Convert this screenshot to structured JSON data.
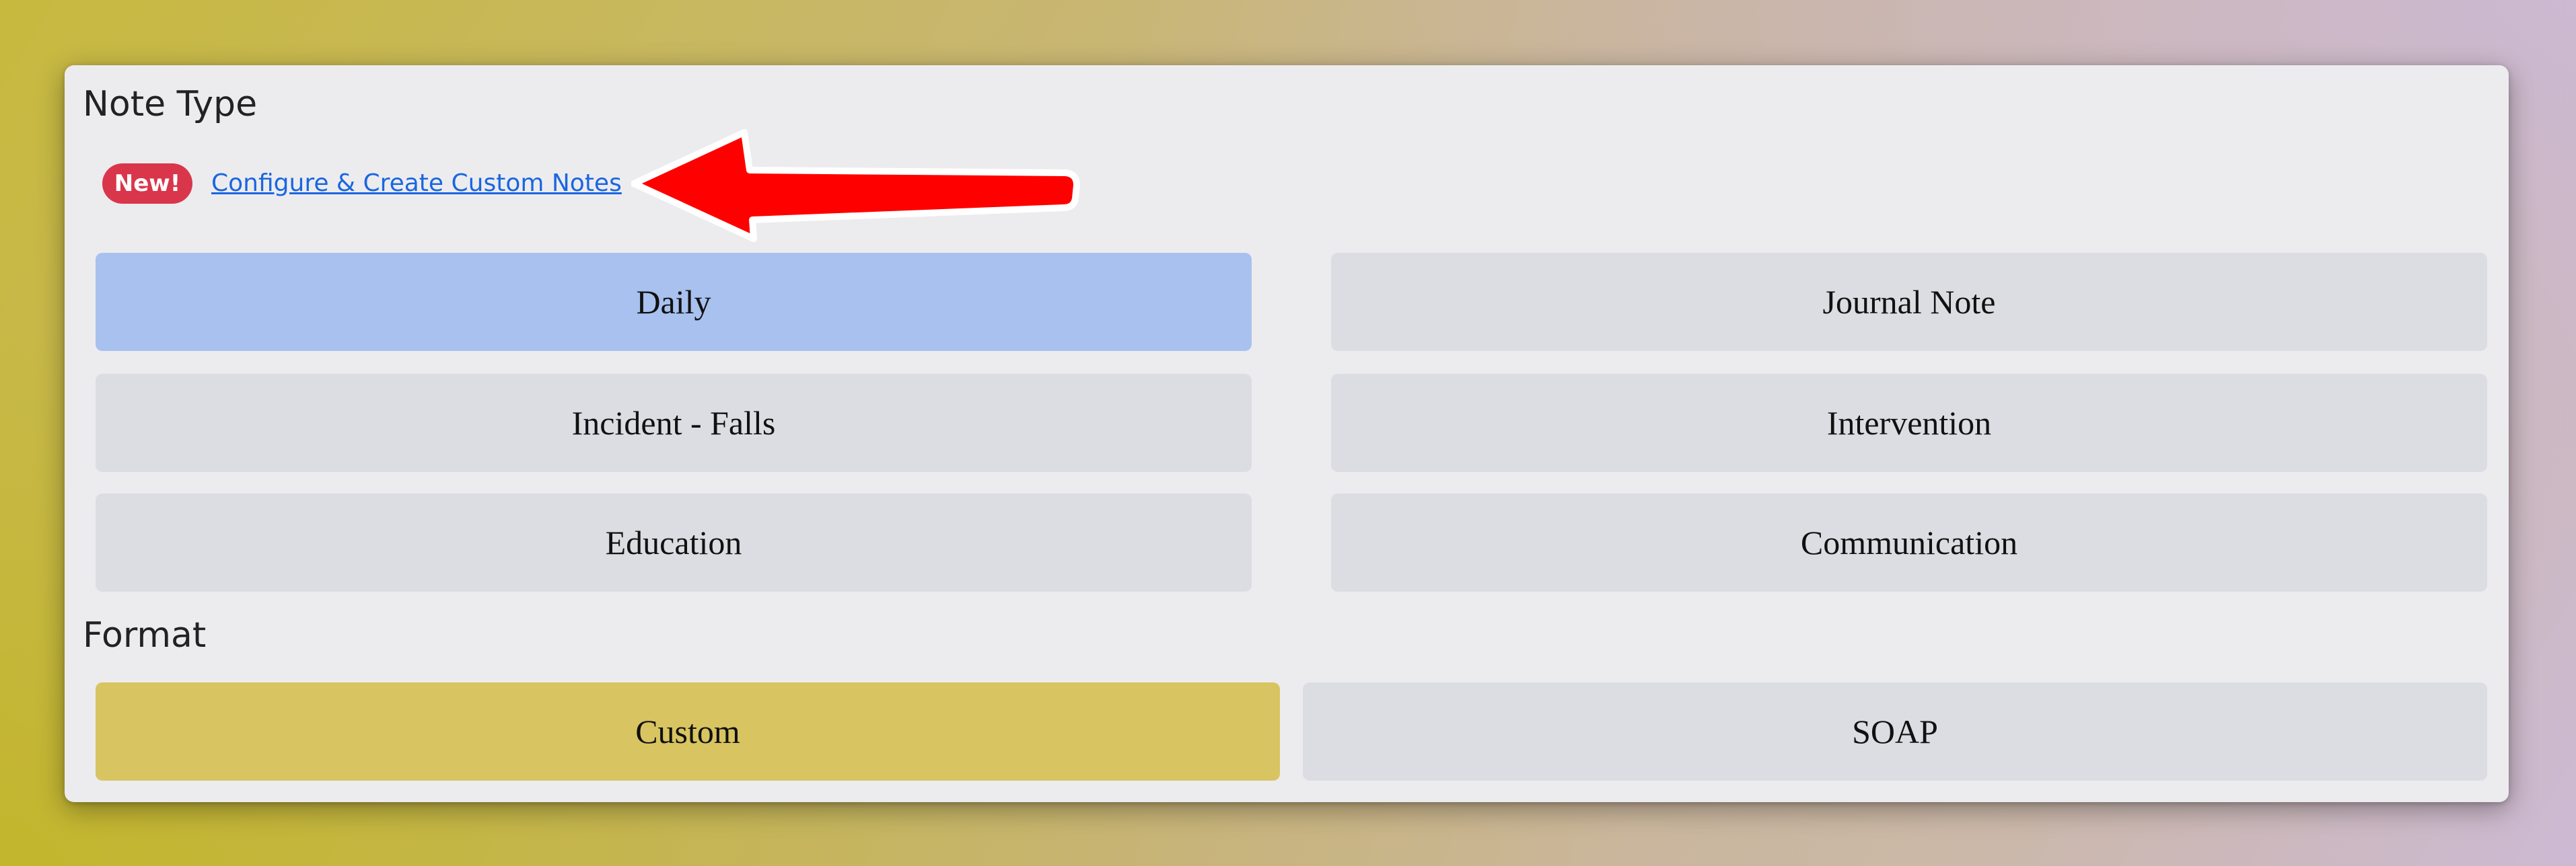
{
  "note_type": {
    "title": "Note Type",
    "badge": "New!",
    "link": "Configure & Create Custom Notes",
    "selected": "Daily",
    "options": [
      {
        "label": "Daily"
      },
      {
        "label": "Journal Note"
      },
      {
        "label": "Incident - Falls"
      },
      {
        "label": "Intervention"
      },
      {
        "label": "Education"
      },
      {
        "label": "Communication"
      }
    ]
  },
  "format": {
    "title": "Format",
    "selected": "Custom",
    "options": [
      {
        "label": "Custom"
      },
      {
        "label": "SOAP"
      }
    ]
  },
  "colors": {
    "selected_note_type": "#a8c1ef",
    "selected_format": "#d8c461",
    "badge": "#d9364b",
    "link": "#1a66e0",
    "annotation_arrow": "#ff0000"
  },
  "icons": {
    "annotation": "red-arrow-icon"
  }
}
